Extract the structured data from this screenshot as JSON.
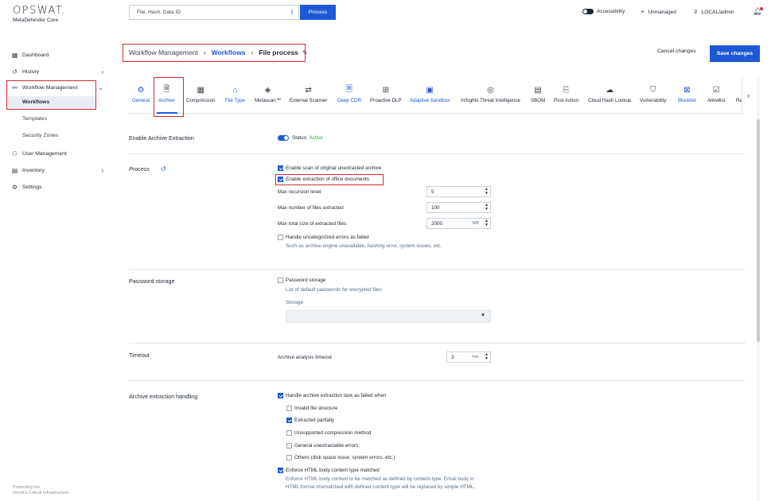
{
  "brand": {
    "name": "OPSWAT.",
    "product": "MetaDefender Core"
  },
  "search": {
    "placeholder": "File, Hash, Data ID",
    "process_label": "Process"
  },
  "topbar": {
    "accessibility": "Accessibility",
    "unmanaged": "Unmanaged",
    "user": "LOCAL/admin"
  },
  "sidebar": {
    "dashboard": "Dashboard",
    "history": "History",
    "workflow_management": "Workflow Management",
    "workflows": "Workflows",
    "templates": "Templates",
    "security_zones": "Security Zones",
    "user_management": "User Management",
    "inventory": "Inventory",
    "settings": "Settings",
    "footer_line1": "Protecting the",
    "footer_line2": "World's Critical Infrastructure"
  },
  "breadcrumb": {
    "root": "Workflow Management",
    "section": "Workflows",
    "current": "File process"
  },
  "actions": {
    "cancel": "Cancel changes",
    "save": "Save changes"
  },
  "tabs": [
    {
      "label": "General",
      "icon": "gear-icon"
    },
    {
      "label": "Archive",
      "icon": "archive-file-icon"
    },
    {
      "label": "Compression",
      "icon": "grid-icon"
    },
    {
      "label": "File Type",
      "icon": "building-icon"
    },
    {
      "label": "Metascan™",
      "icon": "layers-icon"
    },
    {
      "label": "External Scanner",
      "icon": "swap-icon"
    },
    {
      "label": "Deep CDR",
      "icon": "document-icon"
    },
    {
      "label": "Proactive DLP",
      "icon": "tree-icon"
    },
    {
      "label": "Adaptive Sandbox",
      "icon": "sandbox-icon"
    },
    {
      "label": "InSights Threat Intelligence",
      "icon": "fingerprint-icon"
    },
    {
      "label": "SBOM",
      "icon": "list-document-icon"
    },
    {
      "label": "Post Action",
      "icon": "export-file-icon"
    },
    {
      "label": "Cloud Hash Lookup",
      "icon": "cloud-icon"
    },
    {
      "label": "Vulnerability",
      "icon": "shield-icon"
    },
    {
      "label": "Blocklist",
      "icon": "block-file-icon"
    },
    {
      "label": "Allowlist",
      "icon": "allow-file-icon"
    },
    {
      "label": "Re",
      "icon": ""
    }
  ],
  "archive_extraction": {
    "title": "Enable Archive Extraction",
    "status_label": "Status:",
    "status_value": "Active",
    "enabled": true
  },
  "process": {
    "title": "Process",
    "scan_original": {
      "label": "Enable scan of original unextracted archive",
      "checked": true
    },
    "extract_office": {
      "label": "Enable extraction of office documents",
      "checked": true
    },
    "max_recursion": {
      "label": "Max recursion level",
      "value": "5"
    },
    "max_files": {
      "label": "Max number of files extracted",
      "value": "100"
    },
    "max_size": {
      "label": "Max total size of extracted files",
      "value": "2000",
      "unit": "MB"
    },
    "uncategorized": {
      "label": "Handle uncategorized errors as failed",
      "hint": "Such as archive engine unavailable, hashing error, system issues, etc.",
      "checked": false
    }
  },
  "password_storage": {
    "title": "Password storage",
    "checkbox_label": "Password storage",
    "hint": "List of default passwords for encrypted files",
    "storage_label": "Storage",
    "checked": false
  },
  "timeout": {
    "title": "Timeout",
    "label": "Archive analysis timeout",
    "value": "3",
    "unit": "min"
  },
  "handling": {
    "title": "Archive extraction handling",
    "main": {
      "label": "Handle archive extraction task as failed when",
      "checked": true
    },
    "options": [
      {
        "label": "Invalid file structure",
        "checked": false
      },
      {
        "label": "Extracted partially",
        "checked": true
      },
      {
        "label": "Unsupported compression method",
        "checked": false
      },
      {
        "label": "General unextractable errors",
        "checked": false
      },
      {
        "label": "Others (disk space issue, system errors, etc.)",
        "checked": false
      }
    ],
    "html": {
      "label": "Enforce HTML body content type matched",
      "checked": true,
      "hint1": "Enforce HTML body content to be matched as defined by content-type. Email body in",
      "hint2": "HTML format mismatched with defined content-type will be replaced by simple HTML."
    }
  },
  "colors": {
    "accent": "#1d59d6",
    "highlight": "#d62a33",
    "status_active": "#2e9e3f"
  }
}
